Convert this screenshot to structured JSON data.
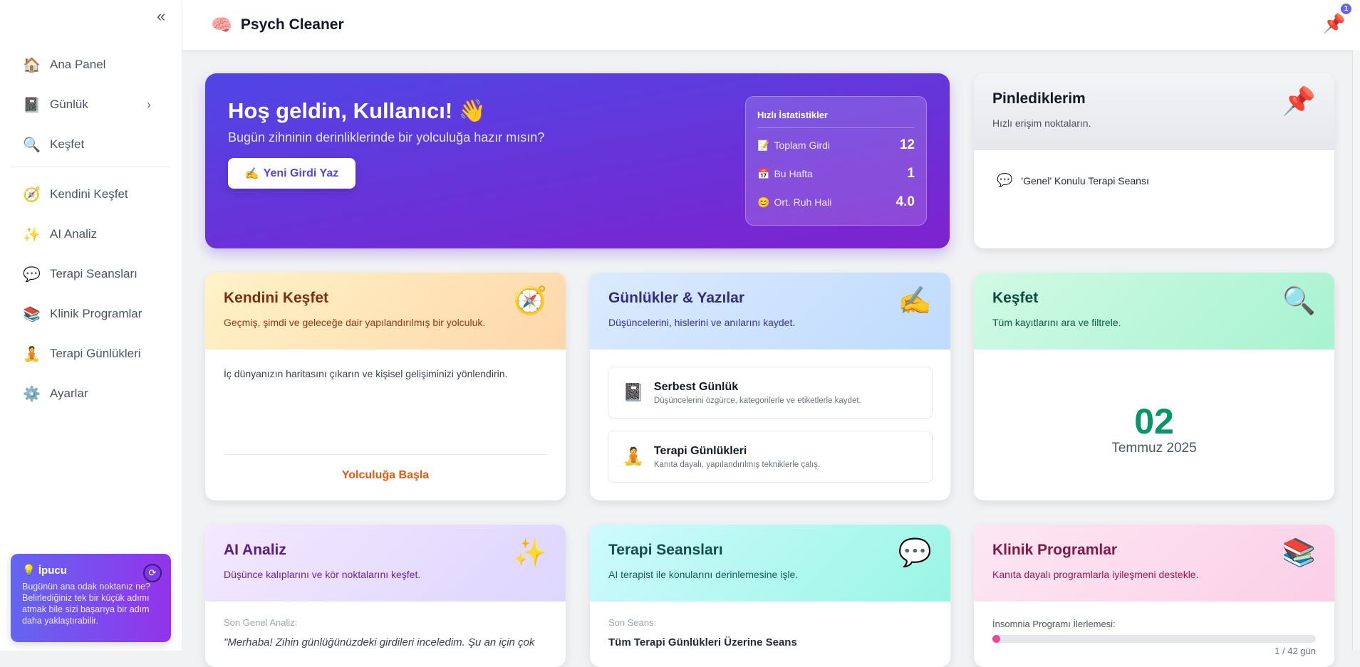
{
  "app": {
    "title": "Psych Cleaner",
    "brand_icon": "🧠",
    "pin_icon": "📌",
    "pin_count": "1"
  },
  "sidebar": {
    "collapse_icon": "«",
    "items": [
      {
        "icon": "🏠",
        "label": "Ana Panel"
      },
      {
        "icon": "📓",
        "label": "Günlük",
        "chevron": "›"
      },
      {
        "icon": "🔍",
        "label": "Keşfet"
      },
      {
        "icon": "🧭",
        "label": "Kendini Keşfet"
      },
      {
        "icon": "✨",
        "label": "AI Analiz"
      },
      {
        "icon": "💬",
        "label": "Terapi Seansları"
      },
      {
        "icon": "📚",
        "label": "Klinik Programlar"
      },
      {
        "icon": "🧘",
        "label": "Terapi Günlükleri"
      },
      {
        "icon": "⚙️",
        "label": "Ayarlar"
      }
    ],
    "tip": {
      "icon": "💡",
      "title": "İpucu",
      "text": "Bugünün ana odak noktanız ne? Belirlediğiniz tek bir küçük adımı atmak bile sizi başarıya bir adım daha yaklaştırabilir.",
      "refresh_icon": "⟳"
    }
  },
  "welcome": {
    "title": "Hoş geldin, Kullanıcı! 👋",
    "subtitle": "Bugün zihninin derinliklerinde bir yolculuğa hazır mısın?",
    "button_icon": "✍️",
    "button": "Yeni Girdi Yaz",
    "stats": {
      "title": "Hızlı İstatistikler",
      "rows": [
        {
          "icon": "📝",
          "label": "Toplam Girdi",
          "value": "12"
        },
        {
          "icon": "📅",
          "label": "Bu Hafta",
          "value": "1"
        },
        {
          "icon": "😊",
          "label": "Ort. Ruh Hali",
          "value": "4.0"
        }
      ]
    }
  },
  "pins": {
    "title": "Pinlediklerim",
    "subtitle": "Hızlı erişim noktaların.",
    "icon": "📌",
    "items": [
      {
        "icon": "💬",
        "label": "'Genel' Konulu Terapi Seansı"
      }
    ]
  },
  "cards": {
    "self": {
      "title": "Kendini Keşfet",
      "subtitle": "Geçmiş, şimdi ve geleceğe dair yapılandırılmış bir yolculuk.",
      "icon": "🧭",
      "body": "İç dünyanızın haritasını çıkarın ve kişisel gelişiminizi yönlendirin.",
      "link": "Yolculuğa Başla"
    },
    "journals": {
      "title": "Günlükler & Yazılar",
      "subtitle": "Düşüncelerini, hislerini ve anılarını kaydet.",
      "icon": "✍️",
      "items": [
        {
          "icon": "📓",
          "title": "Serbest Günlük",
          "desc": "Düşüncelerini özgürce, kategorilerle ve etiketlerle kaydet."
        },
        {
          "icon": "🧘",
          "title": "Terapi Günlükleri",
          "desc": "Kanıta dayalı, yapılandırılmış tekniklerle çalış."
        }
      ]
    },
    "explore": {
      "title": "Keşfet",
      "subtitle": "Tüm kayıtlarını ara ve filtrele.",
      "icon": "🔍",
      "day": "02",
      "month_year": "Temmuz 2025"
    },
    "ai": {
      "title": "AI Analiz",
      "subtitle": "Düşünce kalıplarını ve kör noktalarını keşfet.",
      "icon": "✨",
      "label": "Son Genel Analiz:",
      "quote": "\"Merhaba! Zihin günlüğünüzdeki girdileri inceledim. Şu an için çok"
    },
    "sessions": {
      "title": "Terapi Seansları",
      "subtitle": "AI terapist ile konularını derinlemesine işle.",
      "icon": "💬",
      "label": "Son Seans:",
      "last": "Tüm Terapi Günlükleri Üzerine Seans"
    },
    "clinical": {
      "title": "Klinik Programlar",
      "subtitle": "Kanıta dayalı programlarla iyileşmeni destekle.",
      "icon": "📚",
      "label": "İnsomnia Programı İlerlemesi:",
      "progress_current": 1,
      "progress_total": 42,
      "progress_text": "1 / 42 gün"
    }
  }
}
